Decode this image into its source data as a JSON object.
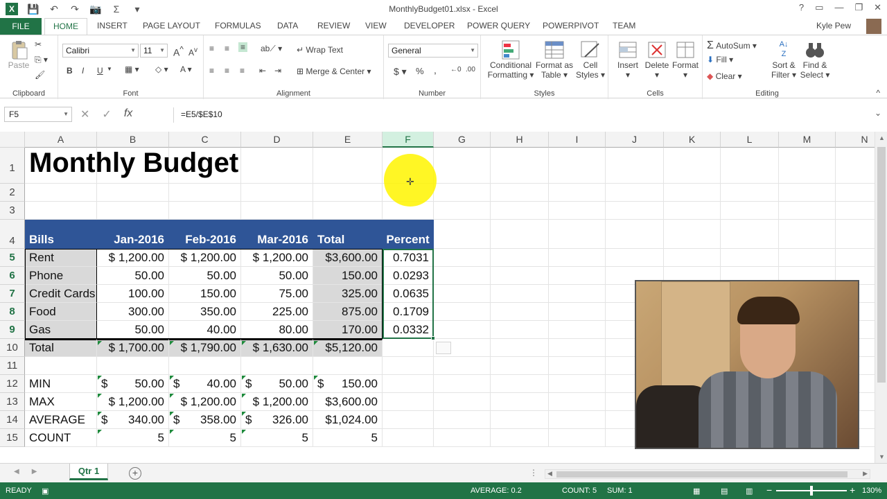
{
  "app": {
    "logo": "X",
    "title": "MonthlyBudget01.xlsx - Excel",
    "user": "Kyle Pew",
    "window_controls": [
      "?",
      "▭",
      "—",
      "❐",
      "✕"
    ]
  },
  "qat": {
    "icons": [
      "save-icon",
      "undo-icon",
      "redo-icon",
      "camera-icon",
      "sum-icon",
      "customize-icon"
    ],
    "glyphs": [
      "💾",
      "↶ ▾",
      "↷ ▾",
      "📷",
      "Σ",
      "▾"
    ]
  },
  "tabs": {
    "file": "FILE",
    "items": [
      "HOME",
      "INSERT",
      "PAGE LAYOUT",
      "FORMULAS",
      "DATA",
      "REVIEW",
      "VIEW",
      "DEVELOPER",
      "POWER QUERY",
      "POWERPIVOT",
      "TEAM"
    ],
    "active": "HOME"
  },
  "ribbon": {
    "clipboard": {
      "label": "Clipboard",
      "paste": "Paste"
    },
    "font": {
      "label": "Font",
      "name": "Calibri",
      "size": "11",
      "bold": "B",
      "italic": "I",
      "underline": "U",
      "grow": "A",
      "shrink": "A",
      "fontcolor": "A"
    },
    "alignment": {
      "label": "Alignment",
      "wrap": "Wrap Text",
      "merge": "Merge & Center"
    },
    "number": {
      "label": "Number",
      "format": "General",
      "currency": "$",
      "percent": "%",
      "comma": ","
    },
    "styles": {
      "label": "Styles",
      "conditional": [
        "Conditional",
        "Formatting"
      ],
      "format_table": [
        "Format as",
        "Table"
      ],
      "cell_styles": [
        "Cell",
        "Styles"
      ]
    },
    "cells": {
      "label": "Cells",
      "insert": "Insert",
      "delete": "Delete",
      "format": "Format"
    },
    "editing": {
      "label": "Editing",
      "autosum": "AutoSum",
      "fill": "Fill",
      "clear": "Clear",
      "sort": [
        "Sort &",
        "Filter"
      ],
      "find": [
        "Find &",
        "Select"
      ]
    }
  },
  "formula_bar": {
    "name_box": "F5",
    "cancel": "✕",
    "enter": "✓",
    "fx": "fx",
    "formula": "=E5/$E$10",
    "expand": "⌄"
  },
  "grid": {
    "columns": [
      "A",
      "B",
      "C",
      "D",
      "E",
      "F",
      "G",
      "H",
      "I",
      "J",
      "K",
      "L",
      "M",
      "N"
    ],
    "rows": [
      "1",
      "2",
      "3",
      "4",
      "5",
      "6",
      "7",
      "8",
      "9",
      "10",
      "11",
      "12",
      "13",
      "14",
      "15"
    ],
    "selected_column": "F",
    "title": "Monthly Budget",
    "header": [
      "Bills",
      "Jan-2016",
      "Feb-2016",
      "Mar-2016",
      "Total",
      "Percent"
    ],
    "bills": [
      [
        "Rent",
        "$ 1,200.00",
        "$ 1,200.00",
        "$ 1,200.00",
        "$3,600.00",
        "0.7031"
      ],
      [
        "Phone",
        "50.00",
        "50.00",
        "50.00",
        "150.00",
        "0.0293"
      ],
      [
        "Credit Cards",
        "100.00",
        "150.00",
        "75.00",
        "325.00",
        "0.0635"
      ],
      [
        "Food",
        "300.00",
        "350.00",
        "225.00",
        "875.00",
        "0.1709"
      ],
      [
        "Gas",
        "50.00",
        "40.00",
        "80.00",
        "170.00",
        "0.0332"
      ]
    ],
    "total": [
      "Total",
      "$ 1,700.00",
      "$ 1,790.00",
      "$ 1,630.00",
      "$5,120.00"
    ],
    "stats": [
      {
        "label": "MIN",
        "cells": [
          [
            "$",
            "50.00"
          ],
          [
            "$",
            "40.00"
          ],
          [
            "$",
            "50.00"
          ],
          [
            "$",
            "150.00"
          ]
        ]
      },
      {
        "label": "MAX",
        "cells": [
          [
            "",
            "$ 1,200.00"
          ],
          [
            "",
            "$ 1,200.00"
          ],
          [
            "",
            "$ 1,200.00"
          ],
          [
            "",
            "$3,600.00"
          ]
        ]
      },
      {
        "label": "AVERAGE",
        "cells": [
          [
            "$",
            "340.00"
          ],
          [
            "$",
            "358.00"
          ],
          [
            "$",
            "326.00"
          ],
          [
            "",
            "$1,024.00"
          ]
        ]
      },
      {
        "label": "COUNT",
        "cells": [
          [
            "",
            "5"
          ],
          [
            "",
            "5"
          ],
          [
            "",
            "5"
          ],
          [
            "",
            "5"
          ]
        ]
      }
    ]
  },
  "sheets": {
    "active": "Qtr 1",
    "add": "+"
  },
  "status": {
    "mode": "READY",
    "average": "AVERAGE: 0.2",
    "count": "COUNT: 5",
    "sum": "SUM: 1",
    "zoom": "130%",
    "zoom_minus": "−",
    "zoom_plus": "+"
  },
  "colors": {
    "excel_green": "#217346",
    "header_blue": "#2f5597",
    "gray_fill": "#d9d9d9",
    "pointer_yellow": "#fff500"
  }
}
